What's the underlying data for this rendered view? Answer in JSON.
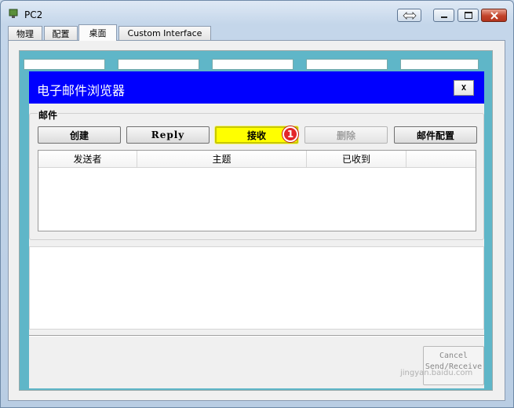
{
  "window": {
    "title": "PC2"
  },
  "tabs": [
    {
      "label": "物理"
    },
    {
      "label": "配置"
    },
    {
      "label": "桌面"
    },
    {
      "label": "Custom Interface"
    }
  ],
  "mail_window": {
    "title": "电子邮件浏览器",
    "close_label": "X",
    "group_label": "邮件",
    "buttons": {
      "create": "创建",
      "reply": "Reply",
      "receive": "接收",
      "delete": "删除",
      "config": "邮件配置"
    },
    "badge": "1",
    "columns": [
      "发送者",
      "主题",
      "已收到",
      ""
    ],
    "cancel_line1": "Cancel",
    "cancel_line2": "Send/Receive"
  },
  "watermark": "jingyan.baidu.com",
  "colors": {
    "mail_header": "#0000ff",
    "highlight": "#ffff00",
    "badge": "#e3262a",
    "desktop": "#5fb6c8"
  }
}
